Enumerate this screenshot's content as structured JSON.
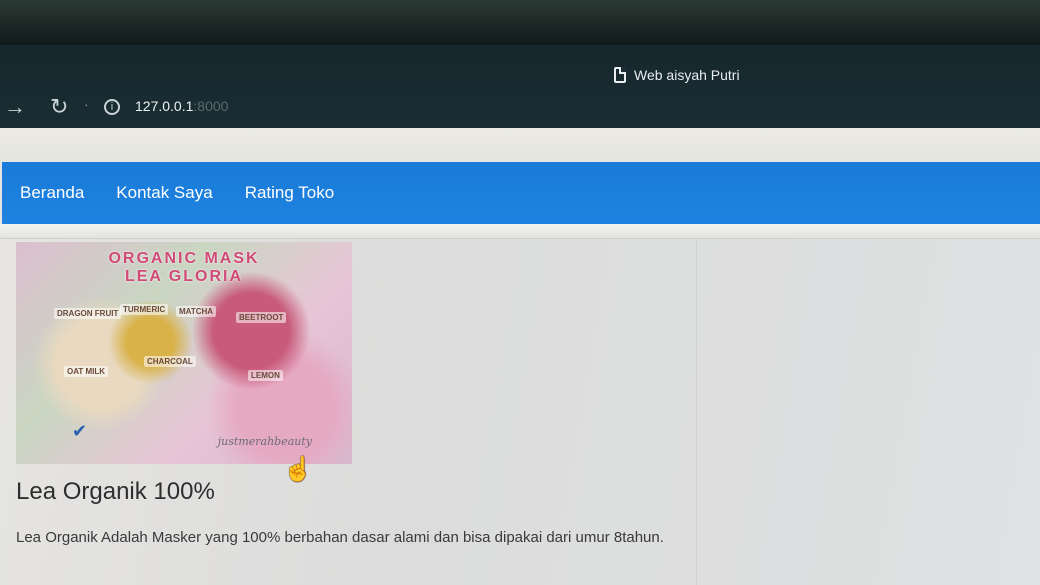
{
  "browser": {
    "tab_title": "Web aisyah Putri",
    "url_host": "127.0.0.1",
    "url_port": ":8000",
    "icons": {
      "tab": "document-icon",
      "forward": "forward-arrow-icon",
      "reload": "reload-icon",
      "info": "info-icon"
    }
  },
  "navbar": {
    "color": "#1f82e0",
    "items": [
      {
        "label": "Beranda"
      },
      {
        "label": "Kontak Saya"
      },
      {
        "label": "Rating Toko"
      }
    ]
  },
  "product": {
    "image": {
      "caption_line1": "ORGANIC MASK",
      "caption_line2": "LEA GLORIA",
      "labels": [
        "DRAGON FRUIT",
        "TURMERIC",
        "MATCHA",
        "BEETROOT",
        "OAT MILK",
        "CHARCOAL",
        "LEMON"
      ],
      "script_text": "justmerahbeauty"
    },
    "title": "Lea Organik 100%",
    "description": "Lea Organik Adalah Masker yang 100% berbahan dasar alami dan bisa dipakai dari umur 8tahun."
  }
}
